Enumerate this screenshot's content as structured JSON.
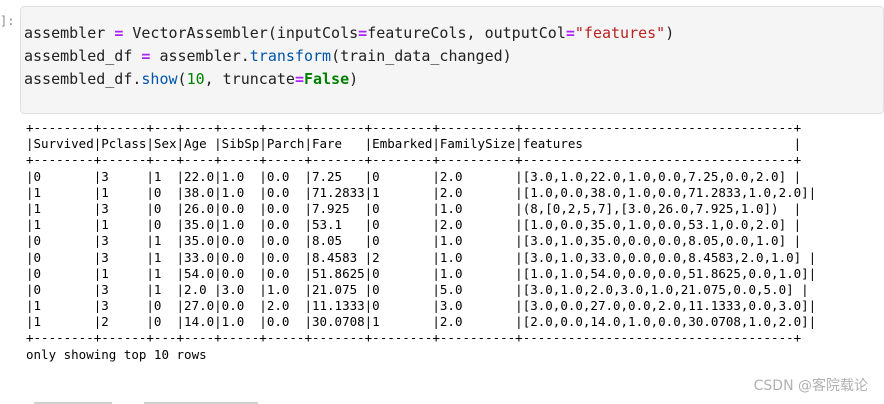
{
  "cell": {
    "prompt": "]:",
    "code": {
      "line1": {
        "a": "assembler ",
        "op": "=",
        "b": " VectorAssembler(inputCols",
        "op2": "=",
        "c": "featureCols, outputCol",
        "op3": "=",
        "str": "\"features\"",
        "d": ")"
      },
      "line2": {
        "a": "assembled_df ",
        "op": "=",
        "b": " assembler.",
        "fn": "transform",
        "c": "(train_data_changed)"
      },
      "line3": {
        "a": "assembled_df.",
        "fn": "show",
        "b": "(",
        "num": "10",
        "c": ", truncate",
        "op": "=",
        "kw": "False",
        "d": ")"
      }
    }
  },
  "output": {
    "lines": [
      "+--------+------+---+----+-----+-----+-------+--------+----------+------------------------------------+",
      "|Survived|Pclass|Sex|Age |SibSp|Parch|Fare   |Embarked|FamilySize|features                            |",
      "+--------+------+---+----+-----+-----+-------+--------+----------+------------------------------------+",
      "|0       |3     |1  |22.0|1.0  |0.0  |7.25   |0       |2.0       |[3.0,1.0,22.0,1.0,0.0,7.25,0.0,2.0] |",
      "|1       |1     |0  |38.0|1.0  |0.0  |71.2833|1       |2.0       |[1.0,0.0,38.0,1.0,0.0,71.2833,1.0,2.0]|",
      "|1       |3     |0  |26.0|0.0  |0.0  |7.925  |0       |1.0       |(8,[0,2,5,7],[3.0,26.0,7.925,1.0])  |",
      "|1       |1     |0  |35.0|1.0  |0.0  |53.1   |0       |2.0       |[1.0,0.0,35.0,1.0,0.0,53.1,0.0,2.0] |",
      "|0       |3     |1  |35.0|0.0  |0.0  |8.05   |0       |1.0       |[3.0,1.0,35.0,0.0,0.0,8.05,0.0,1.0] |",
      "|0       |3     |1  |33.0|0.0  |0.0  |8.4583 |2       |1.0       |[3.0,1.0,33.0,0.0,0.0,8.4583,2.0,1.0] |",
      "|0       |1     |1  |54.0|0.0  |0.0  |51.8625|0       |1.0       |[1.0,1.0,54.0,0.0,0.0,51.8625,0.0,1.0]|",
      "|0       |3     |1  |2.0 |3.0  |1.0  |21.075 |0       |5.0       |[3.0,1.0,2.0,3.0,1.0,21.075,0.0,5.0] |",
      "|1       |3     |0  |27.0|0.0  |2.0  |11.1333|0       |3.0       |[3.0,0.0,27.0,0.0,2.0,11.1333,0.0,3.0]|",
      "|1       |2     |0  |14.0|1.0  |0.0  |30.0708|1       |2.0       |[2.0,0.0,14.0,1.0,0.0,30.0708,1.0,2.0]|",
      "+--------+------+---+----+-----+-----+-------+--------+----------+------------------------------------+",
      "only showing top 10 rows"
    ]
  },
  "watermark": "CSDN @客院载论"
}
